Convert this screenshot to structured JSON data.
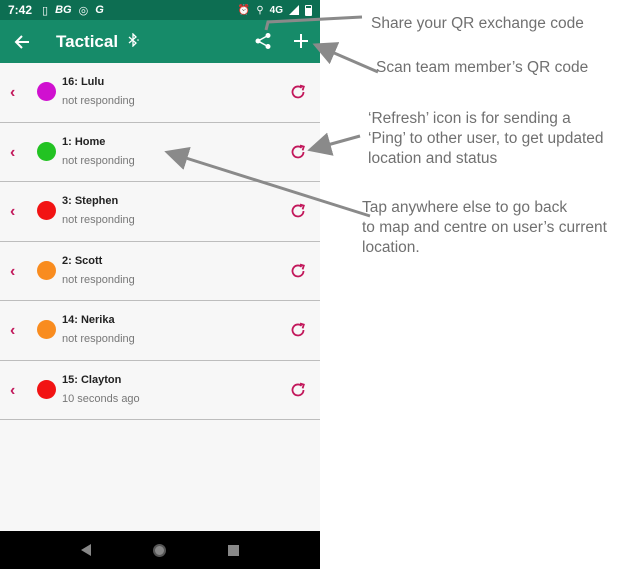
{
  "statusbar": {
    "time": "7:42",
    "icons_left": [
      "sim-icon",
      "BG",
      "camera-icon",
      "G"
    ],
    "network": "4G"
  },
  "appbar": {
    "title": "Tactical",
    "bluetooth_icon": "bluetooth-icon"
  },
  "contacts": [
    {
      "name": "16: Lulu",
      "status": "not responding",
      "color": "#d010d0"
    },
    {
      "name": "1: Home",
      "status": "not responding",
      "color": "#22c322"
    },
    {
      "name": "3: Stephen",
      "status": "not responding",
      "color": "#f21313"
    },
    {
      "name": "2: Scott",
      "status": "not responding",
      "color": "#f98c1f"
    },
    {
      "name": "14: Nerika",
      "status": "not responding",
      "color": "#f98c1f"
    },
    {
      "name": "15: Clayton",
      "status": "10 seconds ago",
      "color": "#f21313"
    }
  ],
  "annotations": {
    "share": "Share your QR exchange code",
    "scan": "Scan team member’s QR code",
    "refresh_1": "‘Refresh’ icon is for sending a",
    "refresh_2": "‘Ping’ to other user, to get updated",
    "refresh_3": "location and status",
    "tap_1": "Tap anywhere else to go back",
    "tap_2": "to map and centre on user’s current",
    "tap_3": "location."
  },
  "colors": {
    "appbar": "#168b69",
    "statusbar": "#0d6e52",
    "accent": "#c2185b"
  }
}
